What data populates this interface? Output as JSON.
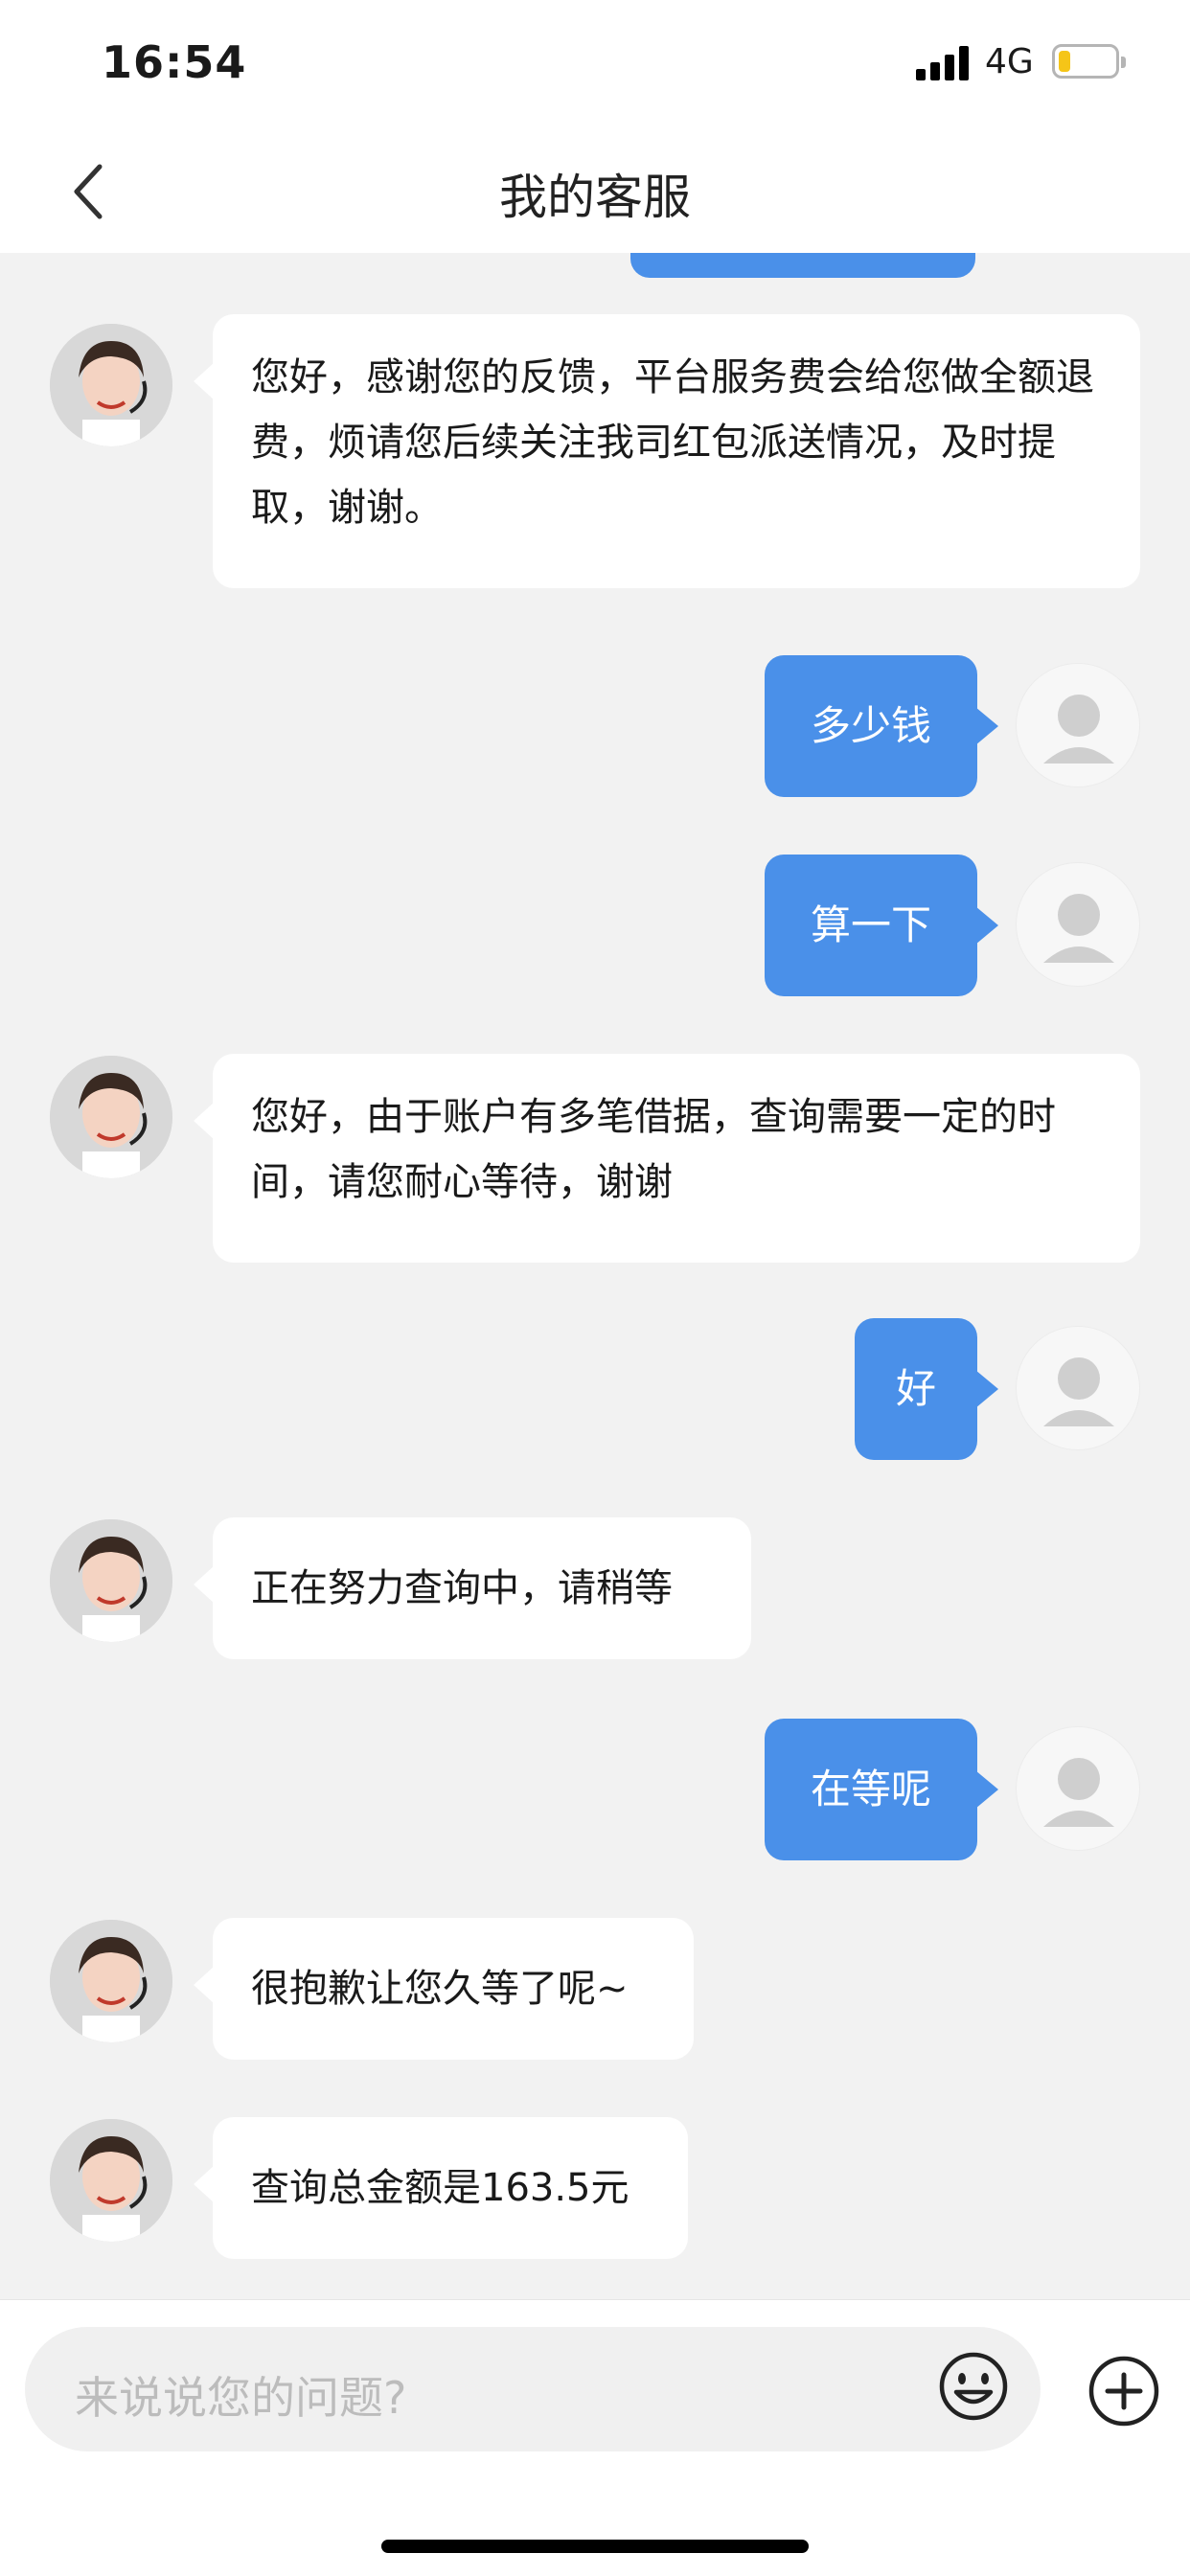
{
  "status_bar": {
    "time": "16:54",
    "network": "4G"
  },
  "nav": {
    "title": "我的客服"
  },
  "messages": [
    {
      "from": "agent",
      "text": "您好，感谢您的反馈，平台服务费会给您做全额退费，烦请您后续关注我司红包派送情况，及时提取，谢谢。"
    },
    {
      "from": "user",
      "text": "多少钱"
    },
    {
      "from": "user",
      "text": "算一下"
    },
    {
      "from": "agent",
      "text": "您好，由于账户有多笔借据，查询需要一定的时间，请您耐心等待，谢谢"
    },
    {
      "from": "user",
      "text": "好"
    },
    {
      "from": "agent",
      "text": "正在努力查询中，请稍等"
    },
    {
      "from": "user",
      "text": "在等呢"
    },
    {
      "from": "agent",
      "text": "很抱歉让您久等了呢~"
    },
    {
      "from": "agent",
      "text": "查询总金额是163.5元"
    }
  ],
  "input": {
    "placeholder": "来说说您的问题?"
  },
  "colors": {
    "accent": "#4a90e9",
    "chat_bg": "#f2f2f2",
    "bubble_in": "#ffffff"
  },
  "icons": [
    "back-chevron-icon",
    "emoji-icon",
    "plus-circle-icon",
    "signal-icon",
    "battery-icon"
  ]
}
